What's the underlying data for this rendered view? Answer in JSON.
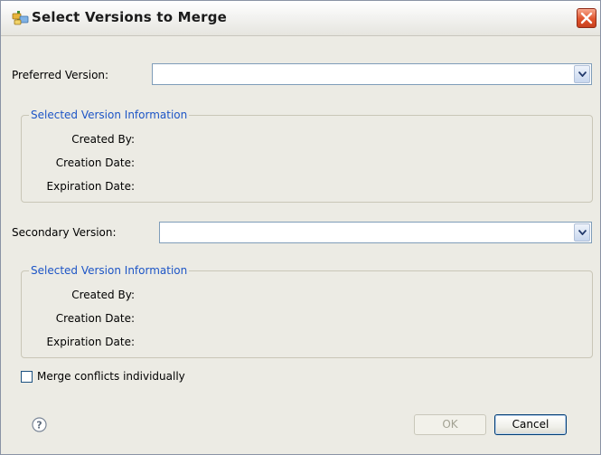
{
  "window": {
    "title": "Select Versions to Merge"
  },
  "preferred": {
    "label": "Preferred Version:",
    "value": "",
    "info": {
      "legend": "Selected Version Information",
      "created_by_label": "Created By:",
      "creation_date_label": "Creation Date:",
      "expiration_date_label": "Expiration Date:",
      "created_by": "",
      "creation_date": "",
      "expiration_date": ""
    }
  },
  "secondary": {
    "label": "Secondary Version:",
    "value": "",
    "info": {
      "legend": "Selected Version Information",
      "created_by_label": "Created By:",
      "creation_date_label": "Creation Date:",
      "expiration_date_label": "Expiration Date:",
      "created_by": "",
      "creation_date": "",
      "expiration_date": ""
    }
  },
  "options": {
    "merge_individually_label": "Merge conflicts individually",
    "merge_individually_checked": false
  },
  "footer": {
    "ok_label": "OK",
    "ok_enabled": false,
    "cancel_label": "Cancel"
  },
  "icons": {
    "app": "folder-tree-icon",
    "close": "close-icon",
    "dropdown": "chevron-down-icon",
    "help": "help-icon"
  },
  "colors": {
    "legend": "#1d55c6",
    "close": "#e0532c",
    "disabled_text": "#a3a293"
  }
}
